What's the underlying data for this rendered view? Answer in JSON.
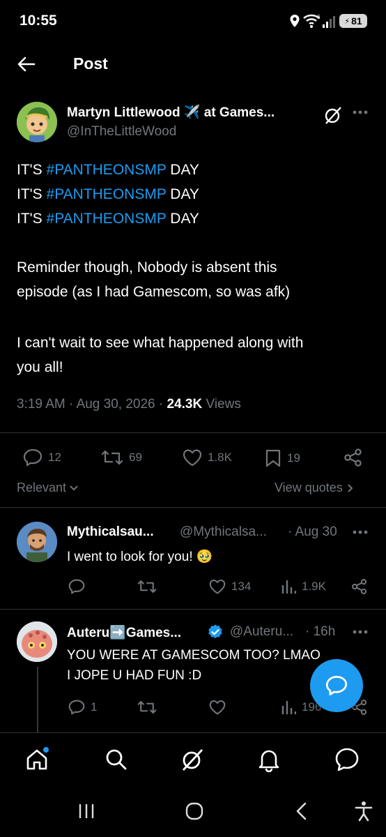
{
  "status_bar": {
    "time": "10:55",
    "battery": "81"
  },
  "header": {
    "title": "Post"
  },
  "main_post": {
    "author_name": "Martyn Littlewood ✈️ at Games...",
    "handle": "@InTheLittleWood",
    "lines": [
      {
        "prefix": "IT'S ",
        "hashtag": "#PANTHEONSMP",
        "suffix": " DAY"
      },
      {
        "prefix": "IT'S ",
        "hashtag": "#PANTHEONSMP",
        "suffix": " DAY"
      },
      {
        "prefix": "IT'S ",
        "hashtag": "#PANTHEONSMP",
        "suffix": " DAY"
      }
    ],
    "paragraph2": [
      "Reminder though, Nobody is absent this",
      "episode (as I had Gamescom, so was afk)"
    ],
    "paragraph3": [
      "I can't wait to see what happened along with",
      "you all!"
    ],
    "time": "3:19 AM",
    "date": "Aug 30, 2026",
    "views_count": "24.3K",
    "views_label": "Views",
    "replies": "12",
    "reposts": "69",
    "likes": "1.8K",
    "bookmarks": "19"
  },
  "sort": {
    "label": "Relevant",
    "view_quotes": "View quotes"
  },
  "replies": [
    {
      "name": "Mythicalsau...",
      "handle": "@Mythicalsa...",
      "time": "· Aug 30",
      "text": "I went to look for you! 🥹",
      "replies": "",
      "reposts": "",
      "likes": "134",
      "views": "1.9K"
    },
    {
      "name": "Auteru➡️Games...",
      "handle": "@Auteru...",
      "time": "· 16h",
      "lines": [
        "YOU WERE AT GAMESCOM TOO? LMAO",
        "I JOPE U HAD FUN :D"
      ],
      "replies": "1",
      "reposts": "",
      "likes": "",
      "views": "196"
    }
  ],
  "colors": {
    "accent": "#1d9bf0",
    "muted": "#71767b",
    "verified": "#1d9bf0"
  },
  "icons": {
    "back": "arrow-left-icon",
    "grok": "grok-icon",
    "more": "more-icon",
    "fab": "compose-reply-icon"
  }
}
